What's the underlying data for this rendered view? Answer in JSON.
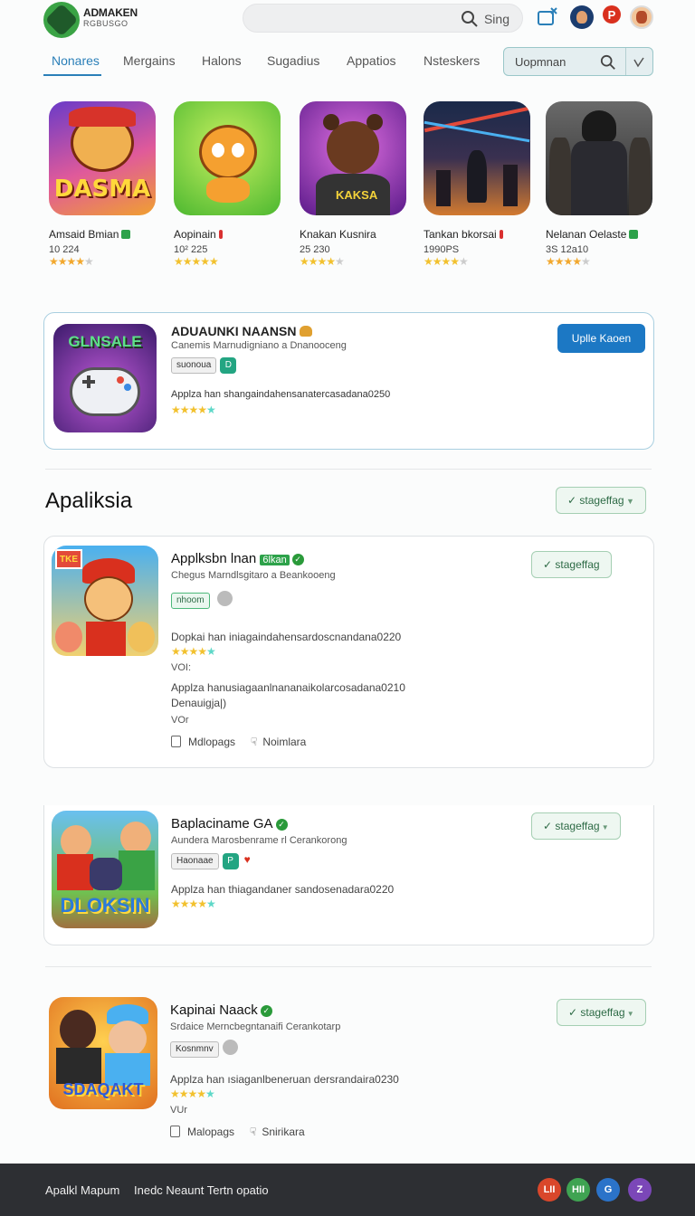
{
  "header": {
    "brand_title": "ADMAKEN",
    "brand_sub": "RGBUSGO",
    "search_label": "Sing"
  },
  "tabs": [
    {
      "label": "Nonares",
      "active": true
    },
    {
      "label": "Mergains"
    },
    {
      "label": "Halons"
    },
    {
      "label": "Sugadius"
    },
    {
      "label": "Appatios"
    },
    {
      "label": "Nsteskers"
    }
  ],
  "filter": {
    "value": "Uopmnan"
  },
  "top_apps": [
    {
      "name": "Amsaid Bmian",
      "count": "10 224",
      "rating": 4,
      "icon": "game-icon-dasma",
      "badge": "#2da24a",
      "art_text": "DASMA"
    },
    {
      "name": "Aopinain",
      "count": "10² 225",
      "rating": 4.5,
      "icon": "game-icon-monkey",
      "badge": "#d93030",
      "art_text": ""
    },
    {
      "name": "Knakan Kusnira",
      "count": "25 230",
      "rating": 4,
      "icon": "game-icon-bear",
      "badge": "",
      "art_text": "KAKSA"
    },
    {
      "name": "Tankan bkorsai",
      "count": "1990PS",
      "rating": 4,
      "icon": "game-icon-battle",
      "badge": "#d93030",
      "art_text": ""
    },
    {
      "name": "Nelanan Oelaste",
      "count": "3S 12a10",
      "rating": 4,
      "icon": "game-icon-warrior",
      "badge": "#2da24a",
      "art_text": ""
    }
  ],
  "featured": {
    "title": "ADUAUNKI NAANSN",
    "subtitle": "Canemis Marnudigniano a Dnanooceng",
    "chip": "suonoua",
    "chip_icon": "D",
    "description": "Applza han shangaindahensanatercasadana0250",
    "rating": 4,
    "button": "Uplle Kaoen",
    "art_text": "GLNSALE"
  },
  "section": {
    "title": "Apaliksia",
    "dropdown": "stageffag"
  },
  "list_apps": [
    {
      "title": "Applksbn lnan",
      "tag": "6lkan",
      "subtitle": "Chegus Marndlsgitaro a Beankooeng",
      "chip": "nhoom",
      "line1": "Dopkai han iniagaindahensardoscnandana0220",
      "rating": 4,
      "ver1": "VOI:",
      "line2": "Applza hanusiagaanlnananaikolarcosadana0210",
      "line3": "Denauigja|)",
      "ver2": "VOr",
      "action1": "Mdlopags",
      "action2": "Noimlara",
      "button": "stageffag",
      "art_text": "TKE"
    },
    {
      "title": "Baplaciname GA",
      "subtitle": "Aundera Marosbenrame rl Cerankorong",
      "chip": "Haonaae",
      "chip_icon": "P",
      "line1": "Applza han thiagandaner sandosenadara0220",
      "rating": 4,
      "button": "stageffag",
      "art_text": "DLOKSIN"
    },
    {
      "title": "Kapinai Naack",
      "subtitle": "Srdaice Merncbegntanaifi Cerankotarp",
      "chip": "Kosnmnv",
      "line1": "Applza han ısiaganlbeneruan dersrandaira0230",
      "rating": 4,
      "ver1": "VUr",
      "action1": "Malopags",
      "action2": "Snirikara",
      "button": "stageffag",
      "art_text": "SDAQAKT"
    }
  ],
  "footer": {
    "link1": "Apalkl Mapum",
    "link2": "Inedc Neaunt Tertn opatio",
    "icons": [
      {
        "label": "LII",
        "color": "#d9472b"
      },
      {
        "label": "HII",
        "color": "#3fa352"
      },
      {
        "label": "G",
        "color": "#2b73c9"
      },
      {
        "label": "Z",
        "color": "#7b47b8"
      }
    ]
  },
  "colors": {
    "accent": "#2a7fb8",
    "primary_button": "#1c78c4",
    "star": "#f2c12e",
    "footer_bg": "#2d2f33"
  }
}
